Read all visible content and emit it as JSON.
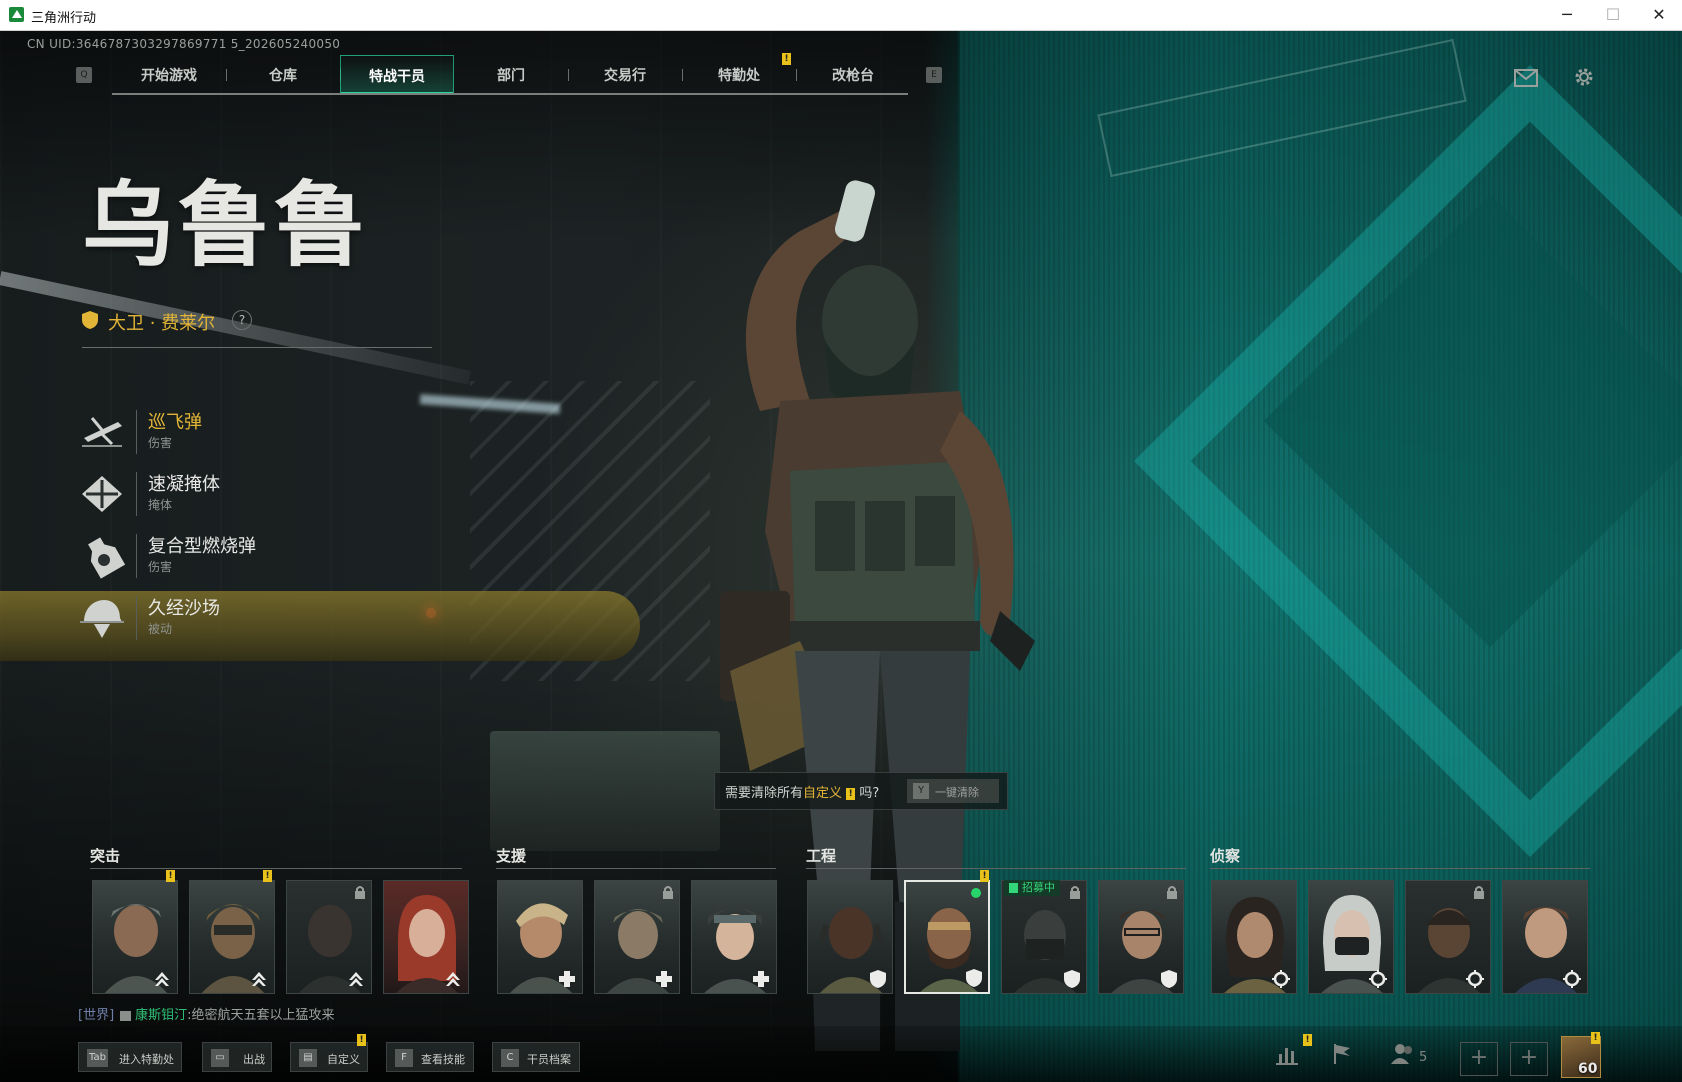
{
  "window": {
    "title": "三角洲行动",
    "controls": {
      "minimize": "─",
      "maximize": "☐",
      "close": "✕"
    }
  },
  "uid": "CN UID:3646787303297869771 5_202605240050",
  "nav": {
    "hotkey_left": "Q",
    "hotkey_right": "E",
    "tabs": [
      {
        "label": "开始游戏",
        "active": false
      },
      {
        "label": "仓库",
        "active": false
      },
      {
        "label": "特战干员",
        "active": true
      },
      {
        "label": "部门",
        "active": false
      },
      {
        "label": "交易行",
        "active": false
      },
      {
        "label": "特勤处",
        "active": false,
        "badge": "!"
      },
      {
        "label": "改枪台",
        "active": false
      }
    ]
  },
  "operator": {
    "codename": "乌鲁鲁",
    "realname": "大卫 · 费莱尔",
    "help": "?",
    "skills": [
      {
        "name": "巡飞弹",
        "type": "伤害",
        "icon": "drone-missile-icon",
        "highlight": true
      },
      {
        "name": "速凝掩体",
        "type": "掩体",
        "icon": "cover-icon",
        "highlight": false
      },
      {
        "name": "复合型燃烧弹",
        "type": "伤害",
        "icon": "incendiary-icon",
        "highlight": false
      },
      {
        "name": "久经沙场",
        "type": "被动",
        "icon": "helmet-icon",
        "highlight": false
      }
    ]
  },
  "clear_prompt": {
    "text_before": "需要清除所有",
    "highlight": "自定义",
    "badge": "!",
    "text_after": "吗?",
    "button_key": "Y",
    "button_label": "一键清除"
  },
  "roster": {
    "classes": [
      {
        "name": "突击"
      },
      {
        "name": "支援"
      },
      {
        "name": "工程"
      },
      {
        "name": "侦察"
      }
    ],
    "recruit_tag": "招募中",
    "badge": "!"
  },
  "chat": {
    "channel": "[世界]",
    "user": "康斯钼汀",
    "message": ":绝密航天五套以上猛攻来"
  },
  "bottom_bar": {
    "buttons": [
      {
        "key": "Tab",
        "label": "进入特勤处"
      },
      {
        "key": "▭",
        "label": "出战"
      },
      {
        "key": "▤",
        "label": "自定义",
        "badge": "!"
      },
      {
        "key": "F",
        "label": "查看技能"
      },
      {
        "key": "C",
        "label": "干员档案"
      }
    ],
    "friends_count": "5",
    "add_slot": "+",
    "level": "60",
    "badge": "!"
  },
  "colors": {
    "accent_green": "#27d69a",
    "gold": "#e3b537",
    "badge_yellow": "#e8c21a",
    "chat_user": "#2fbf74"
  }
}
